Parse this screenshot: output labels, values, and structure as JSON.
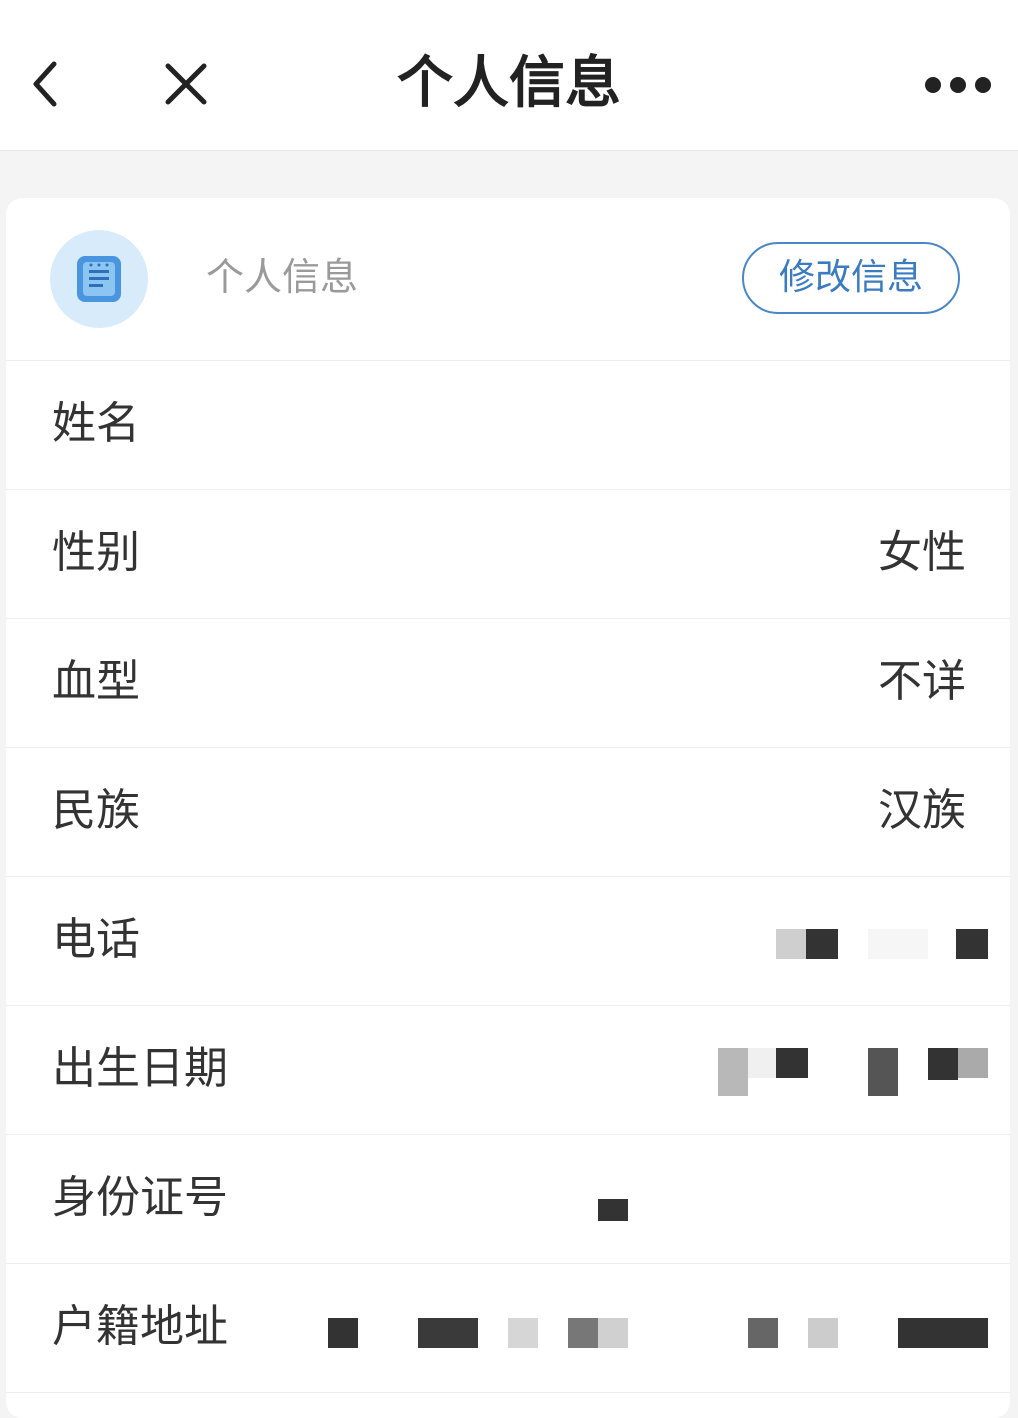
{
  "nav": {
    "title": "个人信息",
    "back_icon": "chevron-left-icon",
    "close_icon": "close-icon",
    "more_icon": "more-dots-icon"
  },
  "card": {
    "icon": "document-icon",
    "header_label": "个人信息",
    "edit_button": "修改信息",
    "accent_color": "#3a7bc2"
  },
  "fields": [
    {
      "label": "姓名",
      "value": ""
    },
    {
      "label": "性别",
      "value": "女性"
    },
    {
      "label": "血型",
      "value": "不详"
    },
    {
      "label": "民族",
      "value": "汉族"
    },
    {
      "label": "电话",
      "value": ""
    },
    {
      "label": "出生日期",
      "value": ""
    },
    {
      "label": "身份证号",
      "value": ""
    },
    {
      "label": "户籍地址",
      "value": ""
    }
  ]
}
